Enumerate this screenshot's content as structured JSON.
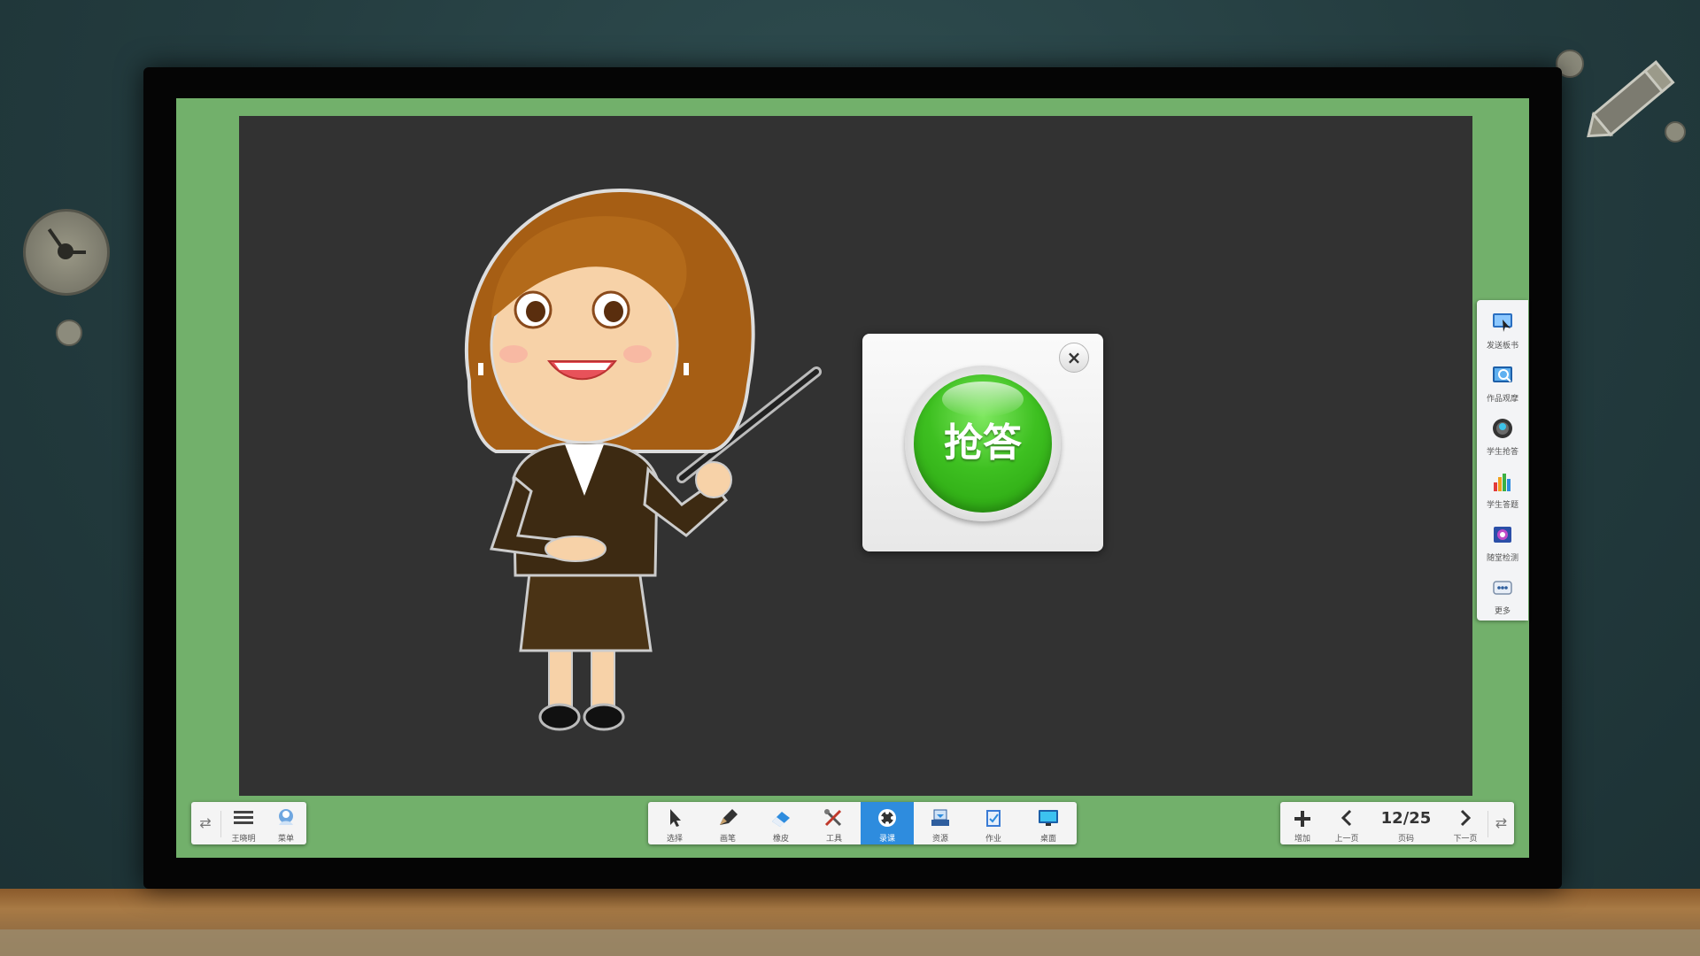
{
  "board": {
    "race_dialog": {
      "button_label": "抢答",
      "close_symbol": "×"
    }
  },
  "side_panel": {
    "items": [
      {
        "label": "发送板书",
        "icon": "send-board-icon"
      },
      {
        "label": "作品观摩",
        "icon": "work-view-icon"
      },
      {
        "label": "学生抢答",
        "icon": "student-race-icon"
      },
      {
        "label": "学生答题",
        "icon": "student-answer-icon"
      },
      {
        "label": "随堂检测",
        "icon": "quiz-icon"
      },
      {
        "label": "更多",
        "icon": "more-icon"
      }
    ]
  },
  "left_bar": {
    "switch_symbol": "⇄",
    "user_label": "王晓明",
    "menu_label": "菜单"
  },
  "center_bar": {
    "tools": [
      {
        "label": "选择",
        "icon": "pointer-icon",
        "active": false
      },
      {
        "label": "画笔",
        "icon": "pen-icon",
        "active": false
      },
      {
        "label": "橡皮",
        "icon": "eraser-icon",
        "active": false
      },
      {
        "label": "工具",
        "icon": "tools-icon",
        "active": false
      },
      {
        "label": "录课",
        "icon": "record-icon",
        "active": true
      },
      {
        "label": "资源",
        "icon": "resource-icon",
        "active": false
      },
      {
        "label": "作业",
        "icon": "homework-icon",
        "active": false
      },
      {
        "label": "桌面",
        "icon": "desktop-icon",
        "active": false
      }
    ]
  },
  "right_bar": {
    "add_label": "增加",
    "prev_label": "上一页",
    "page_value": "12/25",
    "page_label": "页码",
    "next_label": "下一页",
    "switch_symbol": "⇄"
  },
  "colors": {
    "board_green": "#72b06b",
    "stage_bg": "#323232",
    "active_tool": "#2e8cde",
    "race_button": "#3ec021"
  }
}
